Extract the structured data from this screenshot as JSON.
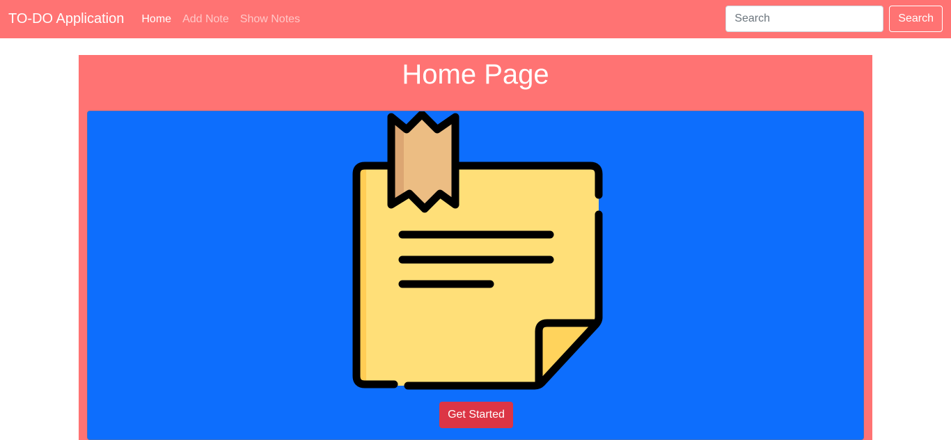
{
  "navbar": {
    "brand": "TO-DO Application",
    "links": [
      {
        "label": "Home",
        "active": true
      },
      {
        "label": "Add Note",
        "active": false
      },
      {
        "label": "Show Notes",
        "active": false
      }
    ],
    "search": {
      "placeholder": "Search",
      "value": "",
      "button_label": "Search"
    }
  },
  "main": {
    "title": "Home Page",
    "illustration_icon": "sticky-note-icon",
    "cta_label": "Get Started"
  },
  "colors": {
    "navbar_bg": "#ff7373",
    "card_bg": "#0d6efd",
    "cta_bg": "#dc3545",
    "note_yellow": "#ffdf78",
    "tape": "#ecbd83"
  }
}
